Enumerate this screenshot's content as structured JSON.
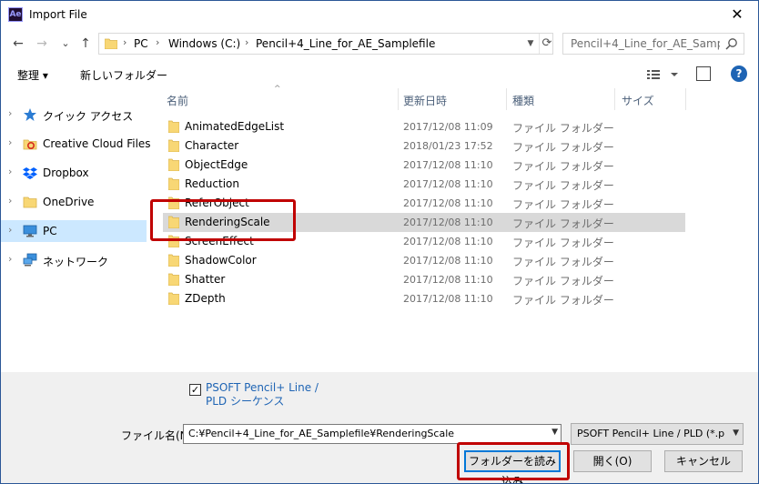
{
  "window": {
    "title": "Import File",
    "app_badge": "Ae",
    "close_glyph": "✕"
  },
  "nav": {
    "back": "←",
    "forward": "→",
    "recent": "⌄",
    "up": "↑",
    "breadcrumb": [
      "PC",
      "Windows (C:)",
      "Pencil+4_Line_for_AE_Samplefile"
    ],
    "search_placeholder": "Pencil+4_Line_for_AE_Sample..."
  },
  "toolbar": {
    "organize": "整理 ▾",
    "new_folder": "新しいフォルダー",
    "help": "?"
  },
  "sidebar": {
    "items": [
      {
        "label": "クイック アクセス",
        "icon": "star-icon"
      },
      {
        "label": "Creative Cloud Files",
        "icon": "creative-cloud-icon"
      },
      {
        "label": "Dropbox",
        "icon": "dropbox-icon"
      },
      {
        "label": "OneDrive",
        "icon": "folder-icon"
      },
      {
        "label": "PC",
        "icon": "monitor-icon",
        "selected": true
      },
      {
        "label": "ネットワーク",
        "icon": "network-icon"
      }
    ]
  },
  "columns": {
    "name": "名前",
    "date": "更新日時",
    "type": "種類",
    "size": "サイズ"
  },
  "files": [
    {
      "name": "AnimatedEdgeList",
      "date": "2017/12/08 11:09",
      "type": "ファイル フォルダー"
    },
    {
      "name": "Character",
      "date": "2018/01/23 17:52",
      "type": "ファイル フォルダー"
    },
    {
      "name": "ObjectEdge",
      "date": "2017/12/08 11:10",
      "type": "ファイル フォルダー"
    },
    {
      "name": "Reduction",
      "date": "2017/12/08 11:10",
      "type": "ファイル フォルダー"
    },
    {
      "name": "ReferObject",
      "date": "2017/12/08 11:10",
      "type": "ファイル フォルダー"
    },
    {
      "name": "RenderingScale",
      "date": "2017/12/08 11:10",
      "type": "ファイル フォルダー",
      "selected": true
    },
    {
      "name": "ScreenEffect",
      "date": "2017/12/08 11:10",
      "type": "ファイル フォルダー"
    },
    {
      "name": "ShadowColor",
      "date": "2017/12/08 11:10",
      "type": "ファイル フォルダー"
    },
    {
      "name": "Shatter",
      "date": "2017/12/08 11:10",
      "type": "ファイル フォルダー"
    },
    {
      "name": "ZDepth",
      "date": "2017/12/08 11:10",
      "type": "ファイル フォルダー"
    }
  ],
  "bottom": {
    "checkbox_mark": "✓",
    "checkbox_label": "PSOFT Pencil+ Line / PLD シーケンス",
    "filename_label": "ファイル名(N):",
    "filename_value": "C:¥Pencil+4_Line_for_AE_Samplefile¥RenderingScale",
    "filter_value": "PSOFT Pencil+ Line / PLD (*.plc",
    "import_folder": "フォルダーを読み込み",
    "open": "開く(O)",
    "cancel": "キャンセル"
  },
  "colors": {
    "highlight": "#c00000",
    "selected_row": "#d9d9d9",
    "selected_nav": "#cce8ff",
    "folder": "#f8d775"
  }
}
